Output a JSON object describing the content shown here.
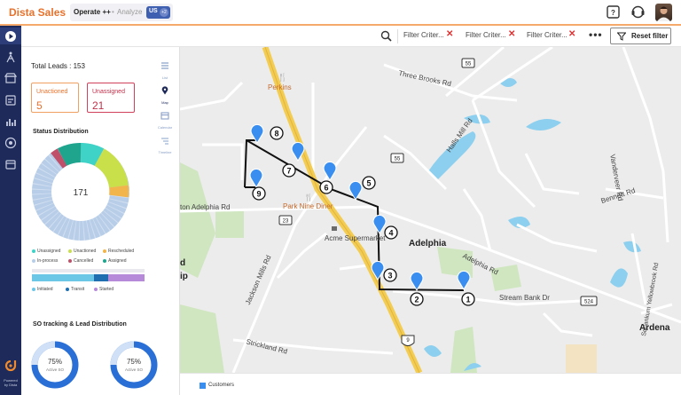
{
  "header": {
    "app_title": "Dista Sales",
    "operate_label": "Operate ++",
    "separator": "•",
    "analyze_label": "Analyze",
    "region_label": "US",
    "region_extra": "+2"
  },
  "leftnav": {
    "items": [
      "play-icon",
      "route-icon",
      "store-icon",
      "orders-icon",
      "chart-icon",
      "target-icon",
      "calendar-icon"
    ],
    "powered_line1": "Powered",
    "powered_line2": "by Dista"
  },
  "filters": {
    "chips": [
      "Filter Criter...",
      "Filter Criter...",
      "Filter Criter..."
    ],
    "more": "•••",
    "reset_label": "Reset filter"
  },
  "panel": {
    "total_leads": "Total Leads : 153",
    "unactioned_label": "Unactioned",
    "unactioned_value": "5",
    "unassigned_label": "Unassigned",
    "unassigned_value": "21",
    "status_title": "Status Distribution",
    "donut_center": "171",
    "legend": [
      {
        "label": "Unassigned",
        "color": "#3fd2c6"
      },
      {
        "label": "Unactioned",
        "color": "#c9e04a"
      },
      {
        "label": "Rescheduled",
        "color": "#f2b54b"
      },
      {
        "label": "In-process",
        "color": "#b7cde8"
      },
      {
        "label": "Cancelled",
        "color": "#c0506a"
      },
      {
        "label": "Assigned",
        "color": "#1fa58e"
      }
    ],
    "bar_legend": [
      {
        "label": "Initiated",
        "color": "#6cc7e6"
      },
      {
        "label": "Transit",
        "color": "#1f6fb0"
      },
      {
        "label": "Started",
        "color": "#b68ad8"
      }
    ],
    "so_title": "SO tracking & Lead Distribution",
    "so_donuts": [
      {
        "percent": "75%",
        "label": "Active SO"
      },
      {
        "percent": "75%",
        "label": "Active SO"
      }
    ],
    "tabs": [
      {
        "label": "List",
        "icon": "list-icon"
      },
      {
        "label": "Map",
        "icon": "map-pin-icon"
      },
      {
        "label": "Calendar",
        "icon": "calendar-icon"
      },
      {
        "label": "Timeline",
        "icon": "timeline-icon"
      }
    ]
  },
  "map": {
    "labels": {
      "three_brooks": "Three Brooks Rd",
      "halls_mill": "Halls Mill Rd",
      "vanderveer": "Vanderveer Rd",
      "bennett": "Bennett Rd",
      "adelphia_rd": "Adelphia Rd",
      "adelphia_rd_left": "ton Adelphia Rd",
      "adelphia_town": "Adelphia",
      "jackson_mills": "Jackson Mills Rd",
      "strickland": "Strickland Rd",
      "stream_bank": "Stream Bank Dr",
      "ardena": "Ardena",
      "squankum": "Squankum Yellowbrook Rd",
      "perkins": "Perkins",
      "park_nine": "Park Nine Diner",
      "acme": "Acme Supermarket",
      "left_d": "d",
      "left_ip": "ip"
    },
    "shields": [
      "55",
      "55",
      "23",
      "524",
      "9"
    ],
    "stops": [
      "1",
      "2",
      "3",
      "4",
      "5",
      "6",
      "7",
      "8",
      "9"
    ],
    "legend_label": "Customers",
    "legend_color": "#3a8ef0"
  }
}
